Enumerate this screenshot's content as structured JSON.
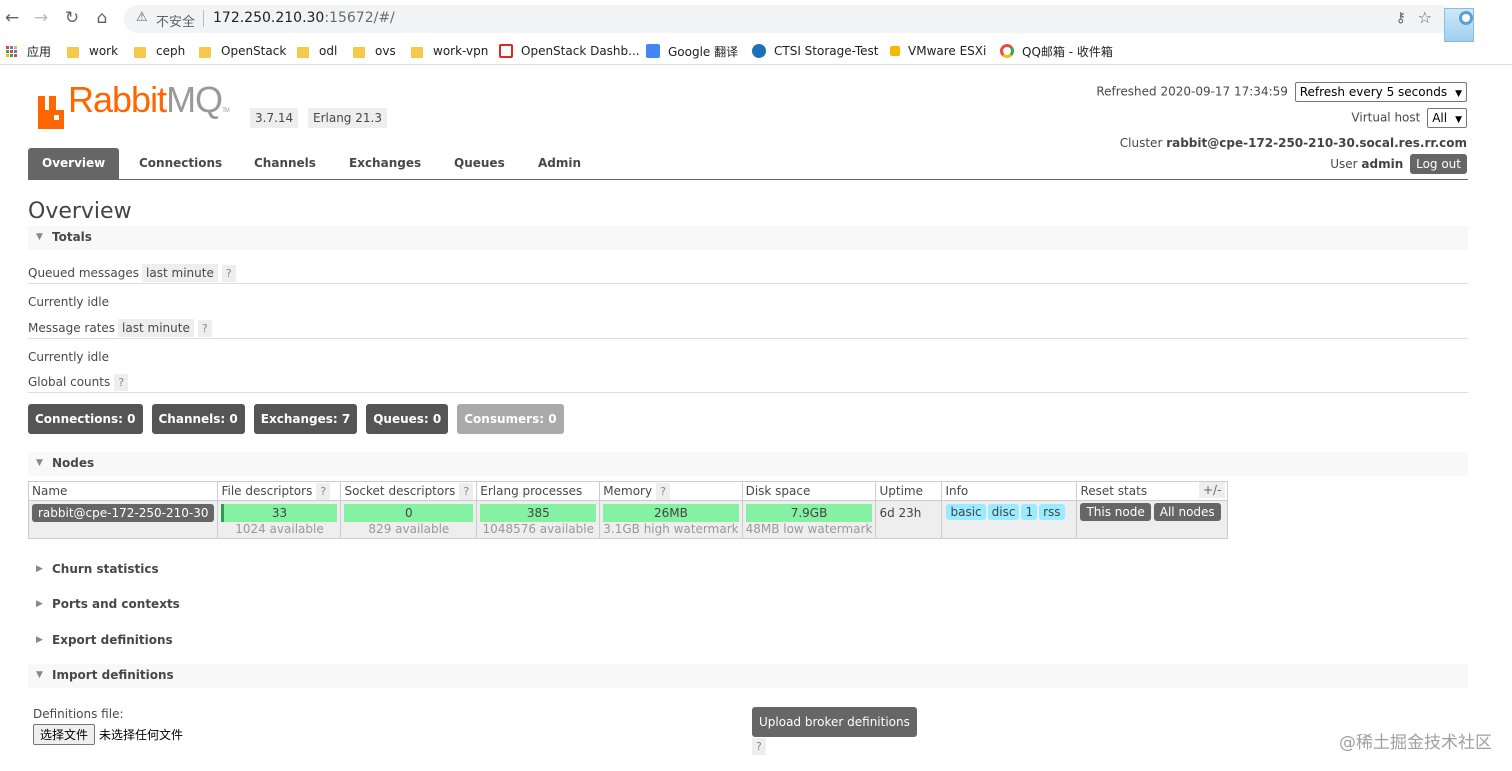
{
  "browser": {
    "security_label": "不安全",
    "url_host": "172.250.210.30",
    "url_rest": ":15672/#/",
    "bookmarks": [
      "应用",
      "work",
      "ceph",
      "OpenStack",
      "odl",
      "ovs",
      "work-vpn",
      "OpenStack Dashb...",
      "Google 翻译",
      "CTSI Storage-Test",
      "VMware ESXi",
      "QQ邮箱 - 收件箱"
    ]
  },
  "header": {
    "logo_rabbit": "Rabbit",
    "logo_mq": "MQ",
    "logo_tm": "TM",
    "version": "3.7.14",
    "erlang": "Erlang 21.3",
    "refreshed_label": "Refreshed 2020-09-17 17:34:59",
    "refresh_select": "Refresh every 5 seconds",
    "vhost_label": "Virtual host",
    "vhost_select": "All",
    "cluster_label": "Cluster",
    "cluster_name": "rabbit@cpe-172-250-210-30.socal.res.rr.com",
    "user_label": "User",
    "user_name": "admin",
    "logout": "Log out"
  },
  "tabs": [
    "Overview",
    "Connections",
    "Channels",
    "Exchanges",
    "Queues",
    "Admin"
  ],
  "page_title": "Overview",
  "totals": {
    "section": "Totals",
    "queued_label": "Queued messages",
    "queued_range": "last minute",
    "help": "?",
    "idle1": "Currently idle",
    "rates_label": "Message rates",
    "rates_range": "last minute",
    "idle2": "Currently idle",
    "global_label": "Global counts",
    "counts": [
      {
        "label": "Connections: 0"
      },
      {
        "label": "Channels: 0"
      },
      {
        "label": "Exchanges: 7"
      },
      {
        "label": "Queues: 0"
      },
      {
        "label": "Consumers: 0"
      }
    ]
  },
  "nodes": {
    "section": "Nodes",
    "headers": [
      "Name",
      "File descriptors",
      "Socket descriptors",
      "Erlang processes",
      "Memory",
      "Disk space",
      "Uptime",
      "Info",
      "Reset stats"
    ],
    "plus_minus": "+/-",
    "row": {
      "name": "rabbit@cpe-172-250-210-30",
      "fd": "33",
      "fd_sub": "1024 available",
      "sd": "0",
      "sd_sub": "829 available",
      "ep": "385",
      "ep_sub": "1048576 available",
      "mem": "26MB",
      "mem_sub": "3.1GB high watermark",
      "disk": "7.9GB",
      "disk_sub": "48MB low watermark",
      "uptime": "6d 23h",
      "info": [
        "basic",
        "disc",
        "1",
        "rss"
      ],
      "reset_this": "This node",
      "reset_all": "All nodes"
    }
  },
  "sections": {
    "churn": "Churn statistics",
    "ports": "Ports and contexts",
    "export": "Export definitions",
    "import": "Import definitions"
  },
  "import": {
    "file_label": "Definitions file:",
    "choose_btn": "选择文件",
    "no_file": "未选择任何文件",
    "upload": "Upload broker definitions",
    "help": "?"
  },
  "watermark": "@稀土掘金技术社区",
  "colors": {
    "accent": "#ff6600",
    "bar": "#84f1a3",
    "tag": "#99ebff",
    "dark": "#666666"
  }
}
